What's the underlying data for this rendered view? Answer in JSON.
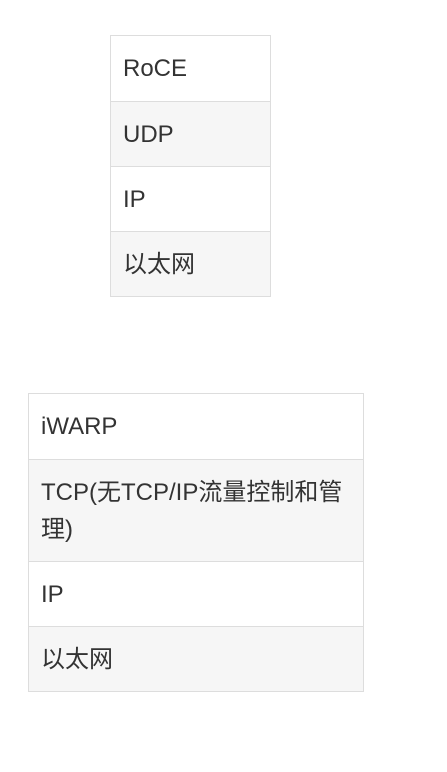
{
  "roce_stack": {
    "layers": [
      "RoCE",
      "UDP",
      "IP",
      "以太网"
    ]
  },
  "iwarp_stack": {
    "layers": [
      "iWARP",
      "TCP(无TCP/IP流量控制和管理)",
      "IP",
      "以太网"
    ]
  }
}
